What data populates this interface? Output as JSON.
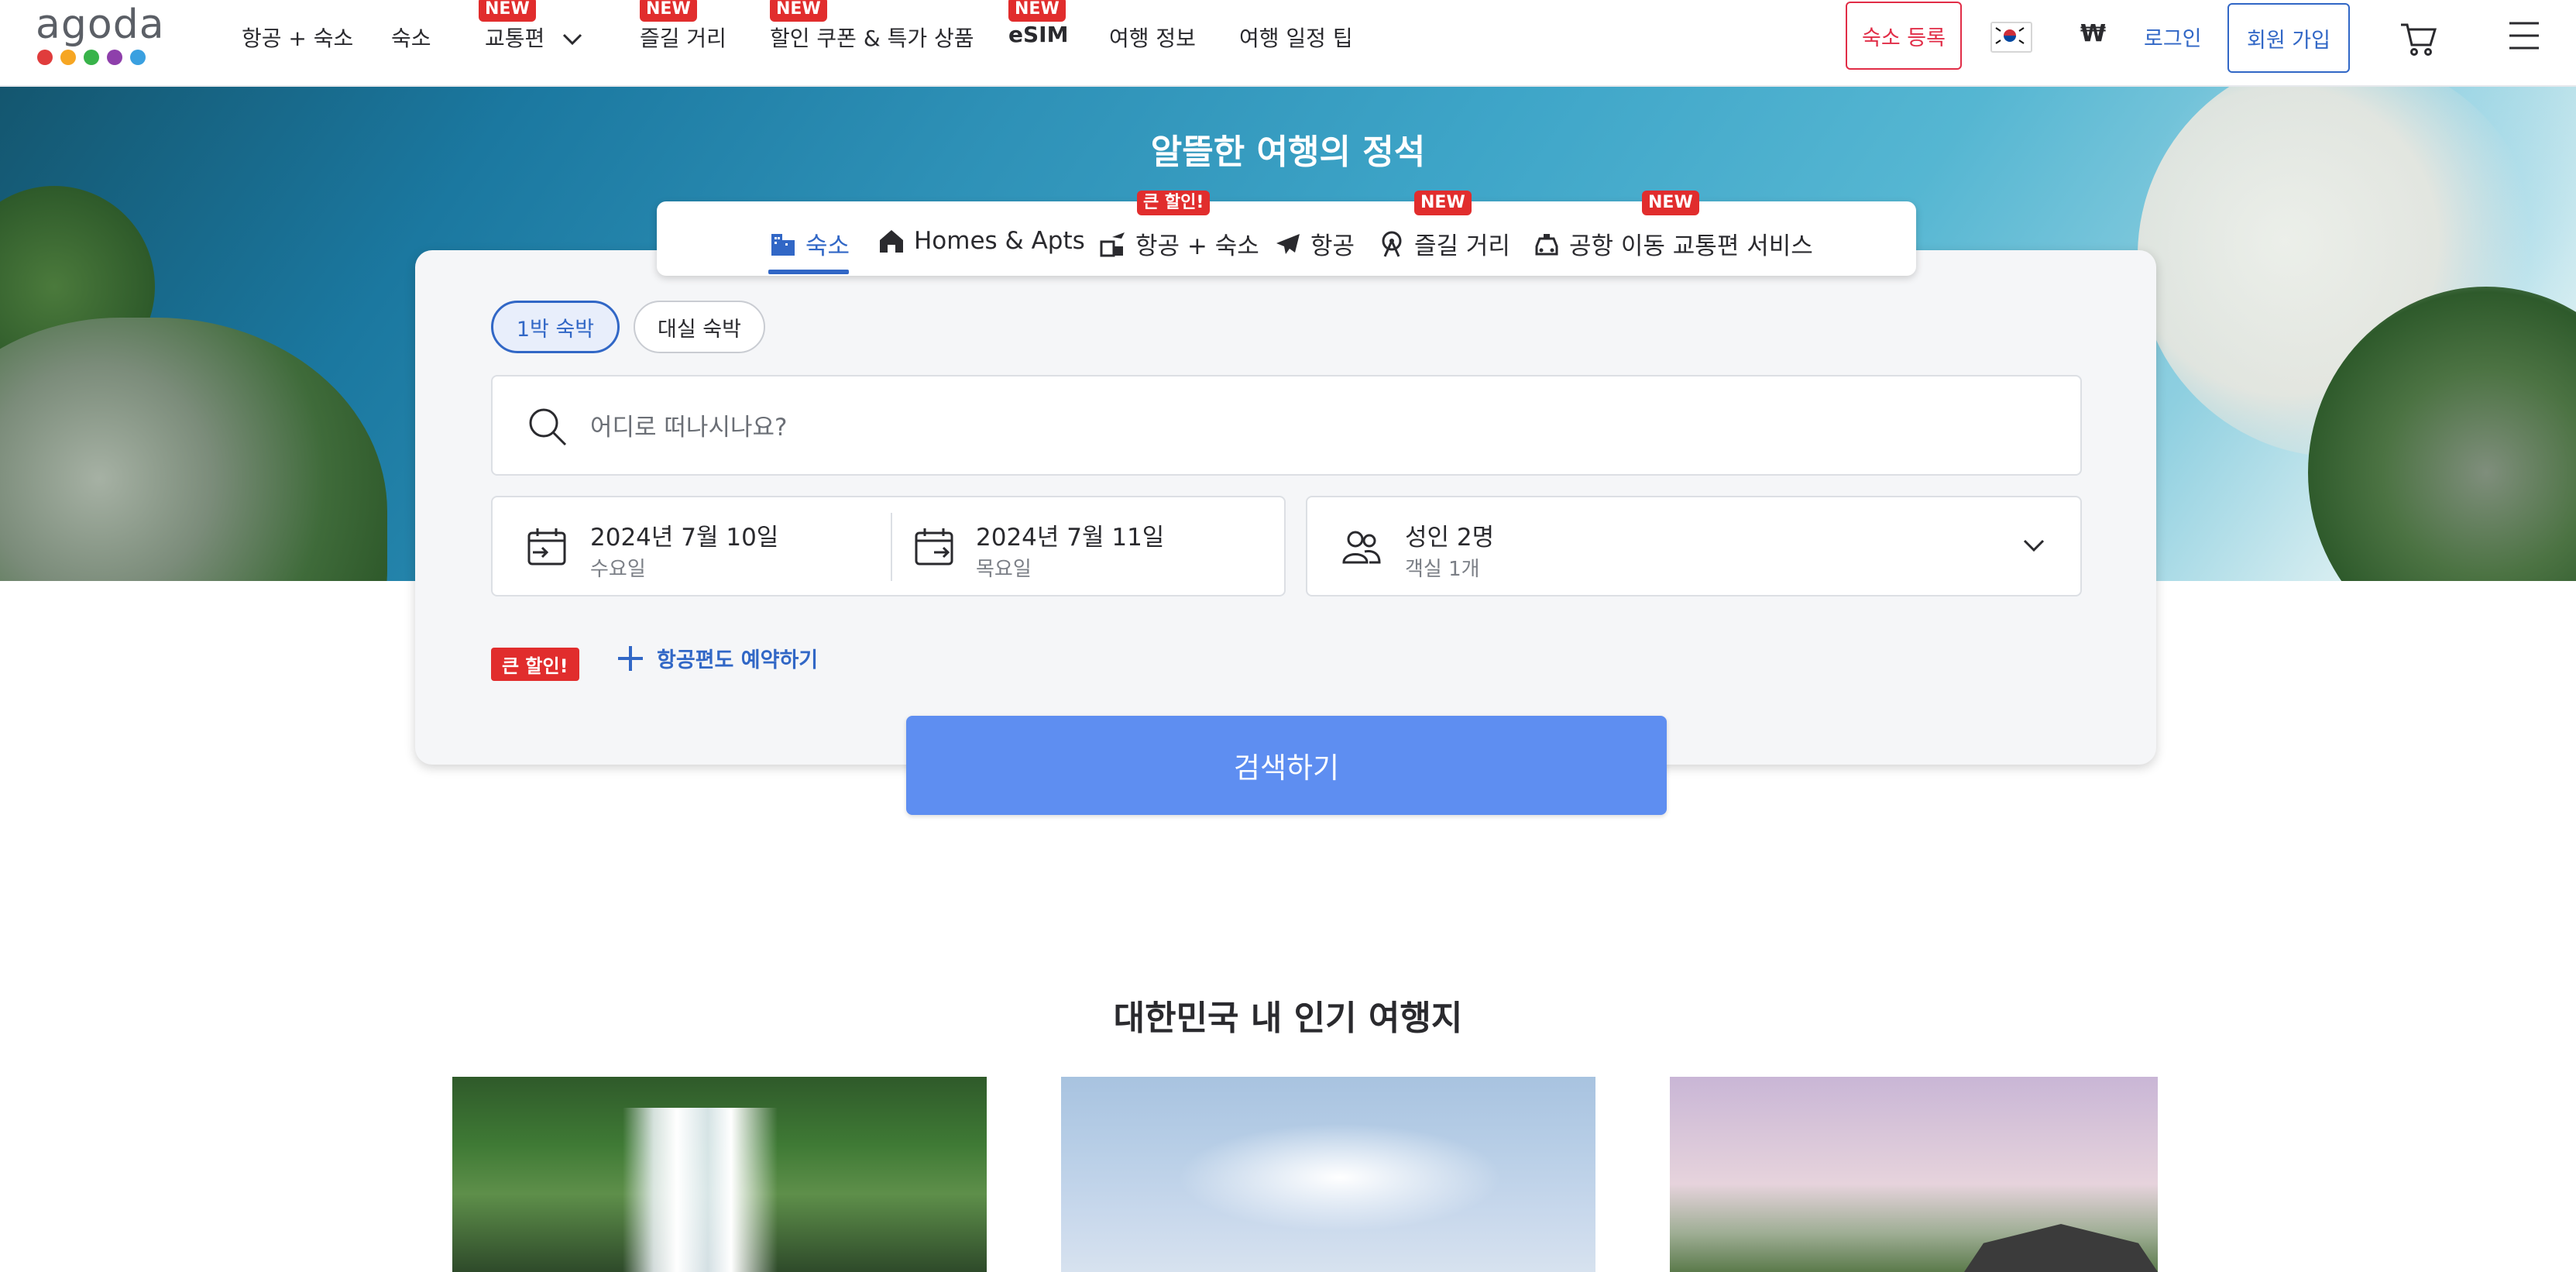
{
  "header": {
    "logo_text": "agoda",
    "logo_dot_colors": [
      "#e03c3c",
      "#f6a623",
      "#38b34a",
      "#8e3fab",
      "#3aa0e0"
    ],
    "nav": [
      {
        "label": "항공 + 숙소",
        "tag": ""
      },
      {
        "label": "숙소",
        "tag": ""
      },
      {
        "label": "교통편",
        "tag": "NEW"
      },
      {
        "label": "즐길 거리",
        "tag": "NEW"
      },
      {
        "label": "할인 쿠폰 & 특가 상품",
        "tag": "NEW"
      },
      {
        "label": "eSIM",
        "tag": "NEW"
      },
      {
        "label": "여행 정보",
        "tag": ""
      },
      {
        "label": "여행 일정 팁",
        "tag": ""
      }
    ],
    "list_property_label": "숙소 등록",
    "currency_symbol": "₩",
    "login_label": "로그인",
    "signup_label": "회원 가입"
  },
  "hero": {
    "title": "알뜰한 여행의 정석"
  },
  "search": {
    "tabs": [
      {
        "label": "숙소",
        "badge": ""
      },
      {
        "label": "Homes & Apts",
        "badge": ""
      },
      {
        "label": "항공 + 숙소",
        "badge": "큰 할인!"
      },
      {
        "label": "항공",
        "badge": ""
      },
      {
        "label": "즐길 거리",
        "badge": "NEW"
      },
      {
        "label": "공항 이동 교통편 서비스",
        "badge": "NEW"
      }
    ],
    "stay_types": [
      "1박 숙박",
      "대실 숙박"
    ],
    "destination_placeholder": "어디로 떠나시나요?",
    "checkin": {
      "date": "2024년 7월 10일",
      "weekday": "수요일"
    },
    "checkout": {
      "date": "2024년 7월 11일",
      "weekday": "목요일"
    },
    "guests": {
      "main": "성인 2명",
      "sub": "객실 1개"
    },
    "discount_badge": "큰 할인!",
    "add_flight_label": "항공편도 예약하기",
    "search_button": "검색하기"
  },
  "popular": {
    "title": "대한민국 내 인기 여행지"
  },
  "colors": {
    "brand_blue": "#3167c6",
    "search_button": "#5e8ef1",
    "new_tag_red": "#e12d2d",
    "list_property_red": "#e12d47"
  }
}
